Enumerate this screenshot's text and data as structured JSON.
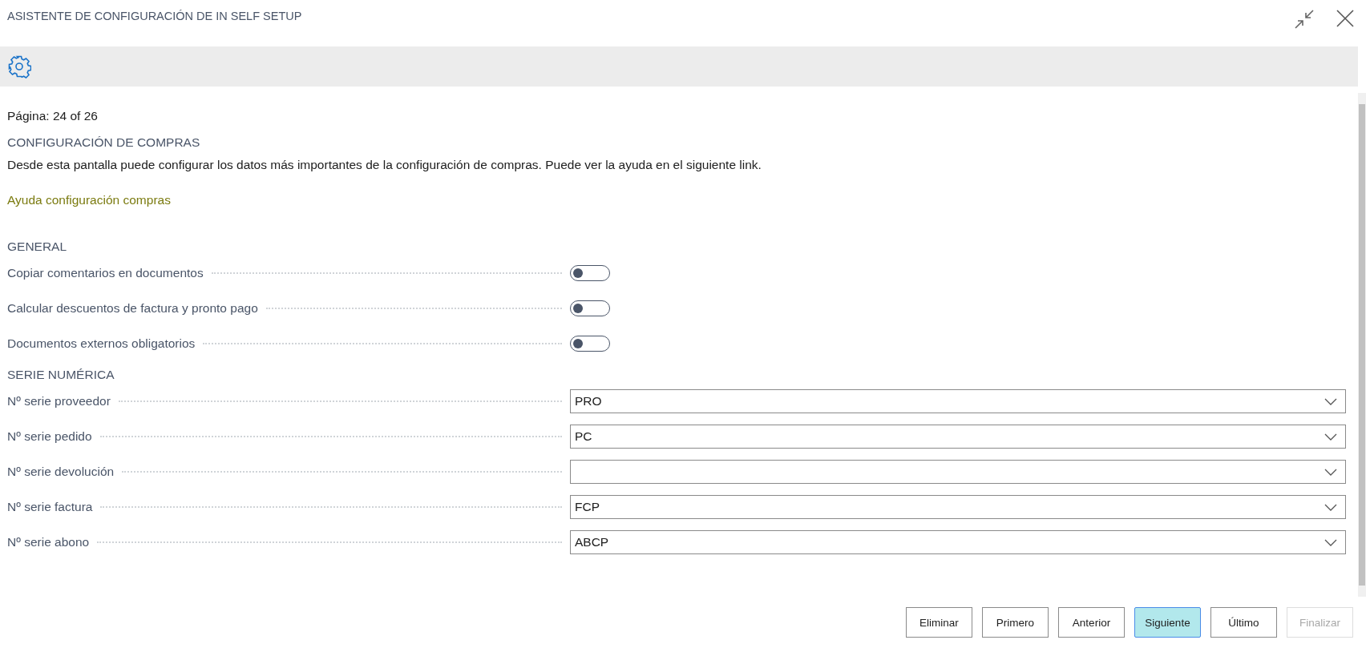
{
  "window": {
    "title": "ASISTENTE DE CONFIGURACIÓN DE IN SELF SETUP"
  },
  "page_indicator": "Página: 24 of 26",
  "section": {
    "title": "CONFIGURACIÓN DE COMPRAS",
    "description": "Desde esta pantalla puede configurar los datos más importantes de la configuración de compras. Puede ver la ayuda en el siguiente link.",
    "link": "Ayuda configuración compras"
  },
  "groups": [
    {
      "title": "GENERAL",
      "fields": [
        {
          "kind": "toggle",
          "label": "Copiar comentarios en documentos",
          "on": false
        },
        {
          "kind": "toggle",
          "label": "Calcular descuentos de factura y pronto pago",
          "on": false
        },
        {
          "kind": "toggle",
          "label": "Documentos externos obligatorios",
          "on": false
        }
      ]
    },
    {
      "title": "SERIE NUMÉRICA",
      "fields": [
        {
          "kind": "dropdown",
          "label": "Nº serie proveedor",
          "value": "PRO"
        },
        {
          "kind": "dropdown",
          "label": "Nº serie pedido",
          "value": "PC"
        },
        {
          "kind": "dropdown",
          "label": "Nº serie devolución"
        },
        {
          "kind": "dropdown",
          "label": "Nº serie factura",
          "value": "FCP"
        },
        {
          "kind": "dropdown",
          "label": "Nº serie abono",
          "value": "ABCP"
        }
      ]
    }
  ],
  "buttons": [
    {
      "label": "Eliminar",
      "selected": false,
      "disabled": false
    },
    {
      "label": "Primero",
      "selected": false,
      "disabled": false
    },
    {
      "label": "Anterior",
      "selected": false,
      "disabled": false
    },
    {
      "label": "Siguiente",
      "selected": true,
      "disabled": false
    },
    {
      "label": "Último",
      "selected": false,
      "disabled": false
    },
    {
      "label": "Finalizar",
      "selected": false,
      "disabled": true
    }
  ]
}
